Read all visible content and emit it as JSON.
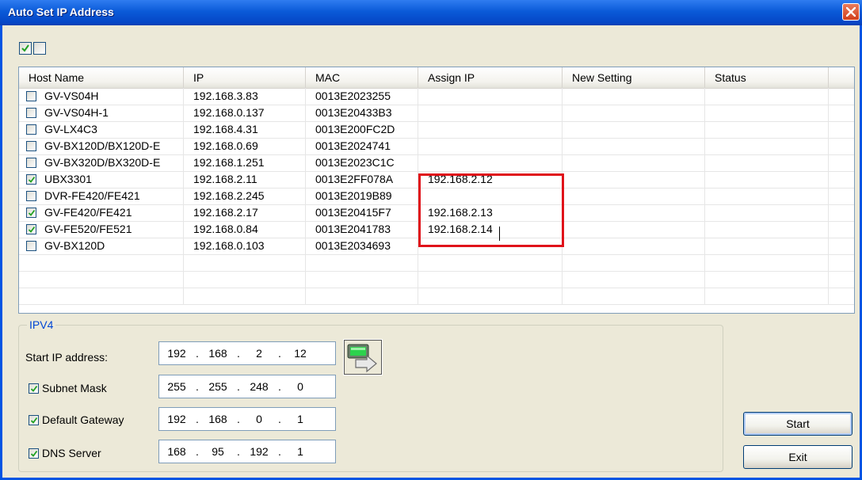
{
  "window": {
    "title": "Auto Set IP Address"
  },
  "toolbar": {
    "select_all_checked": true,
    "select_none_checked": false
  },
  "columns": [
    "Host Name",
    "IP",
    "MAC",
    "Assign IP",
    "New Setting",
    "Status"
  ],
  "rows": [
    {
      "checked": false,
      "host": "GV-VS04H",
      "ip": "192.168.3.83",
      "mac": "0013E2023255",
      "assign": "",
      "setting": "",
      "status": ""
    },
    {
      "checked": false,
      "host": "GV-VS04H-1",
      "ip": "192.168.0.137",
      "mac": "0013E20433B3",
      "assign": "",
      "setting": "",
      "status": ""
    },
    {
      "checked": false,
      "host": "GV-LX4C3",
      "ip": "192.168.4.31",
      "mac": "0013E200FC2D",
      "assign": "",
      "setting": "",
      "status": ""
    },
    {
      "checked": false,
      "host": "GV-BX120D/BX120D-E",
      "ip": "192.168.0.69",
      "mac": "0013E2024741",
      "assign": "",
      "setting": "",
      "status": ""
    },
    {
      "checked": false,
      "host": "GV-BX320D/BX320D-E",
      "ip": "192.168.1.251",
      "mac": "0013E2023C1C",
      "assign": "",
      "setting": "",
      "status": ""
    },
    {
      "checked": true,
      "host": "UBX3301",
      "ip": "192.168.2.11",
      "mac": "0013E2FF078A",
      "assign": "192.168.2.12",
      "setting": "",
      "status": ""
    },
    {
      "checked": false,
      "host": "DVR-FE420/FE421",
      "ip": "192.168.2.245",
      "mac": "0013E2019B89",
      "assign": "",
      "setting": "",
      "status": ""
    },
    {
      "checked": true,
      "host": "GV-FE420/FE421",
      "ip": "192.168.2.17",
      "mac": "0013E20415F7",
      "assign": "192.168.2.13",
      "setting": "",
      "status": ""
    },
    {
      "checked": true,
      "host": "GV-FE520/FE521",
      "ip": "192.168.0.84",
      "mac": "0013E2041783",
      "assign": "192.168.2.14",
      "setting": "",
      "status": ""
    },
    {
      "checked": false,
      "host": "GV-BX120D",
      "ip": "192.168.0.103",
      "mac": "0013E2034693",
      "assign": "",
      "setting": "",
      "status": ""
    }
  ],
  "ipv4": {
    "legend": "IPV4",
    "start_ip": {
      "label": "Start IP address:",
      "octets": [
        "192",
        "168",
        "2",
        "12"
      ]
    },
    "subnet": {
      "label": "Subnet Mask",
      "checked": true,
      "octets": [
        "255",
        "255",
        "248",
        "0"
      ]
    },
    "gateway": {
      "label": "Default Gateway",
      "checked": true,
      "octets": [
        "192",
        "168",
        "0",
        "1"
      ]
    },
    "dns": {
      "label": "DNS Server",
      "checked": true,
      "octets": [
        "168",
        "95",
        "192",
        "1"
      ]
    }
  },
  "buttons": {
    "start": "Start",
    "exit": "Exit"
  },
  "colors": {
    "highlight_box": "#e0121a",
    "title_bar": "#0a5ad8",
    "legend_text": "#0046d5"
  },
  "icons": {
    "apply": "monitor-arrow-icon",
    "close": "close-icon"
  }
}
